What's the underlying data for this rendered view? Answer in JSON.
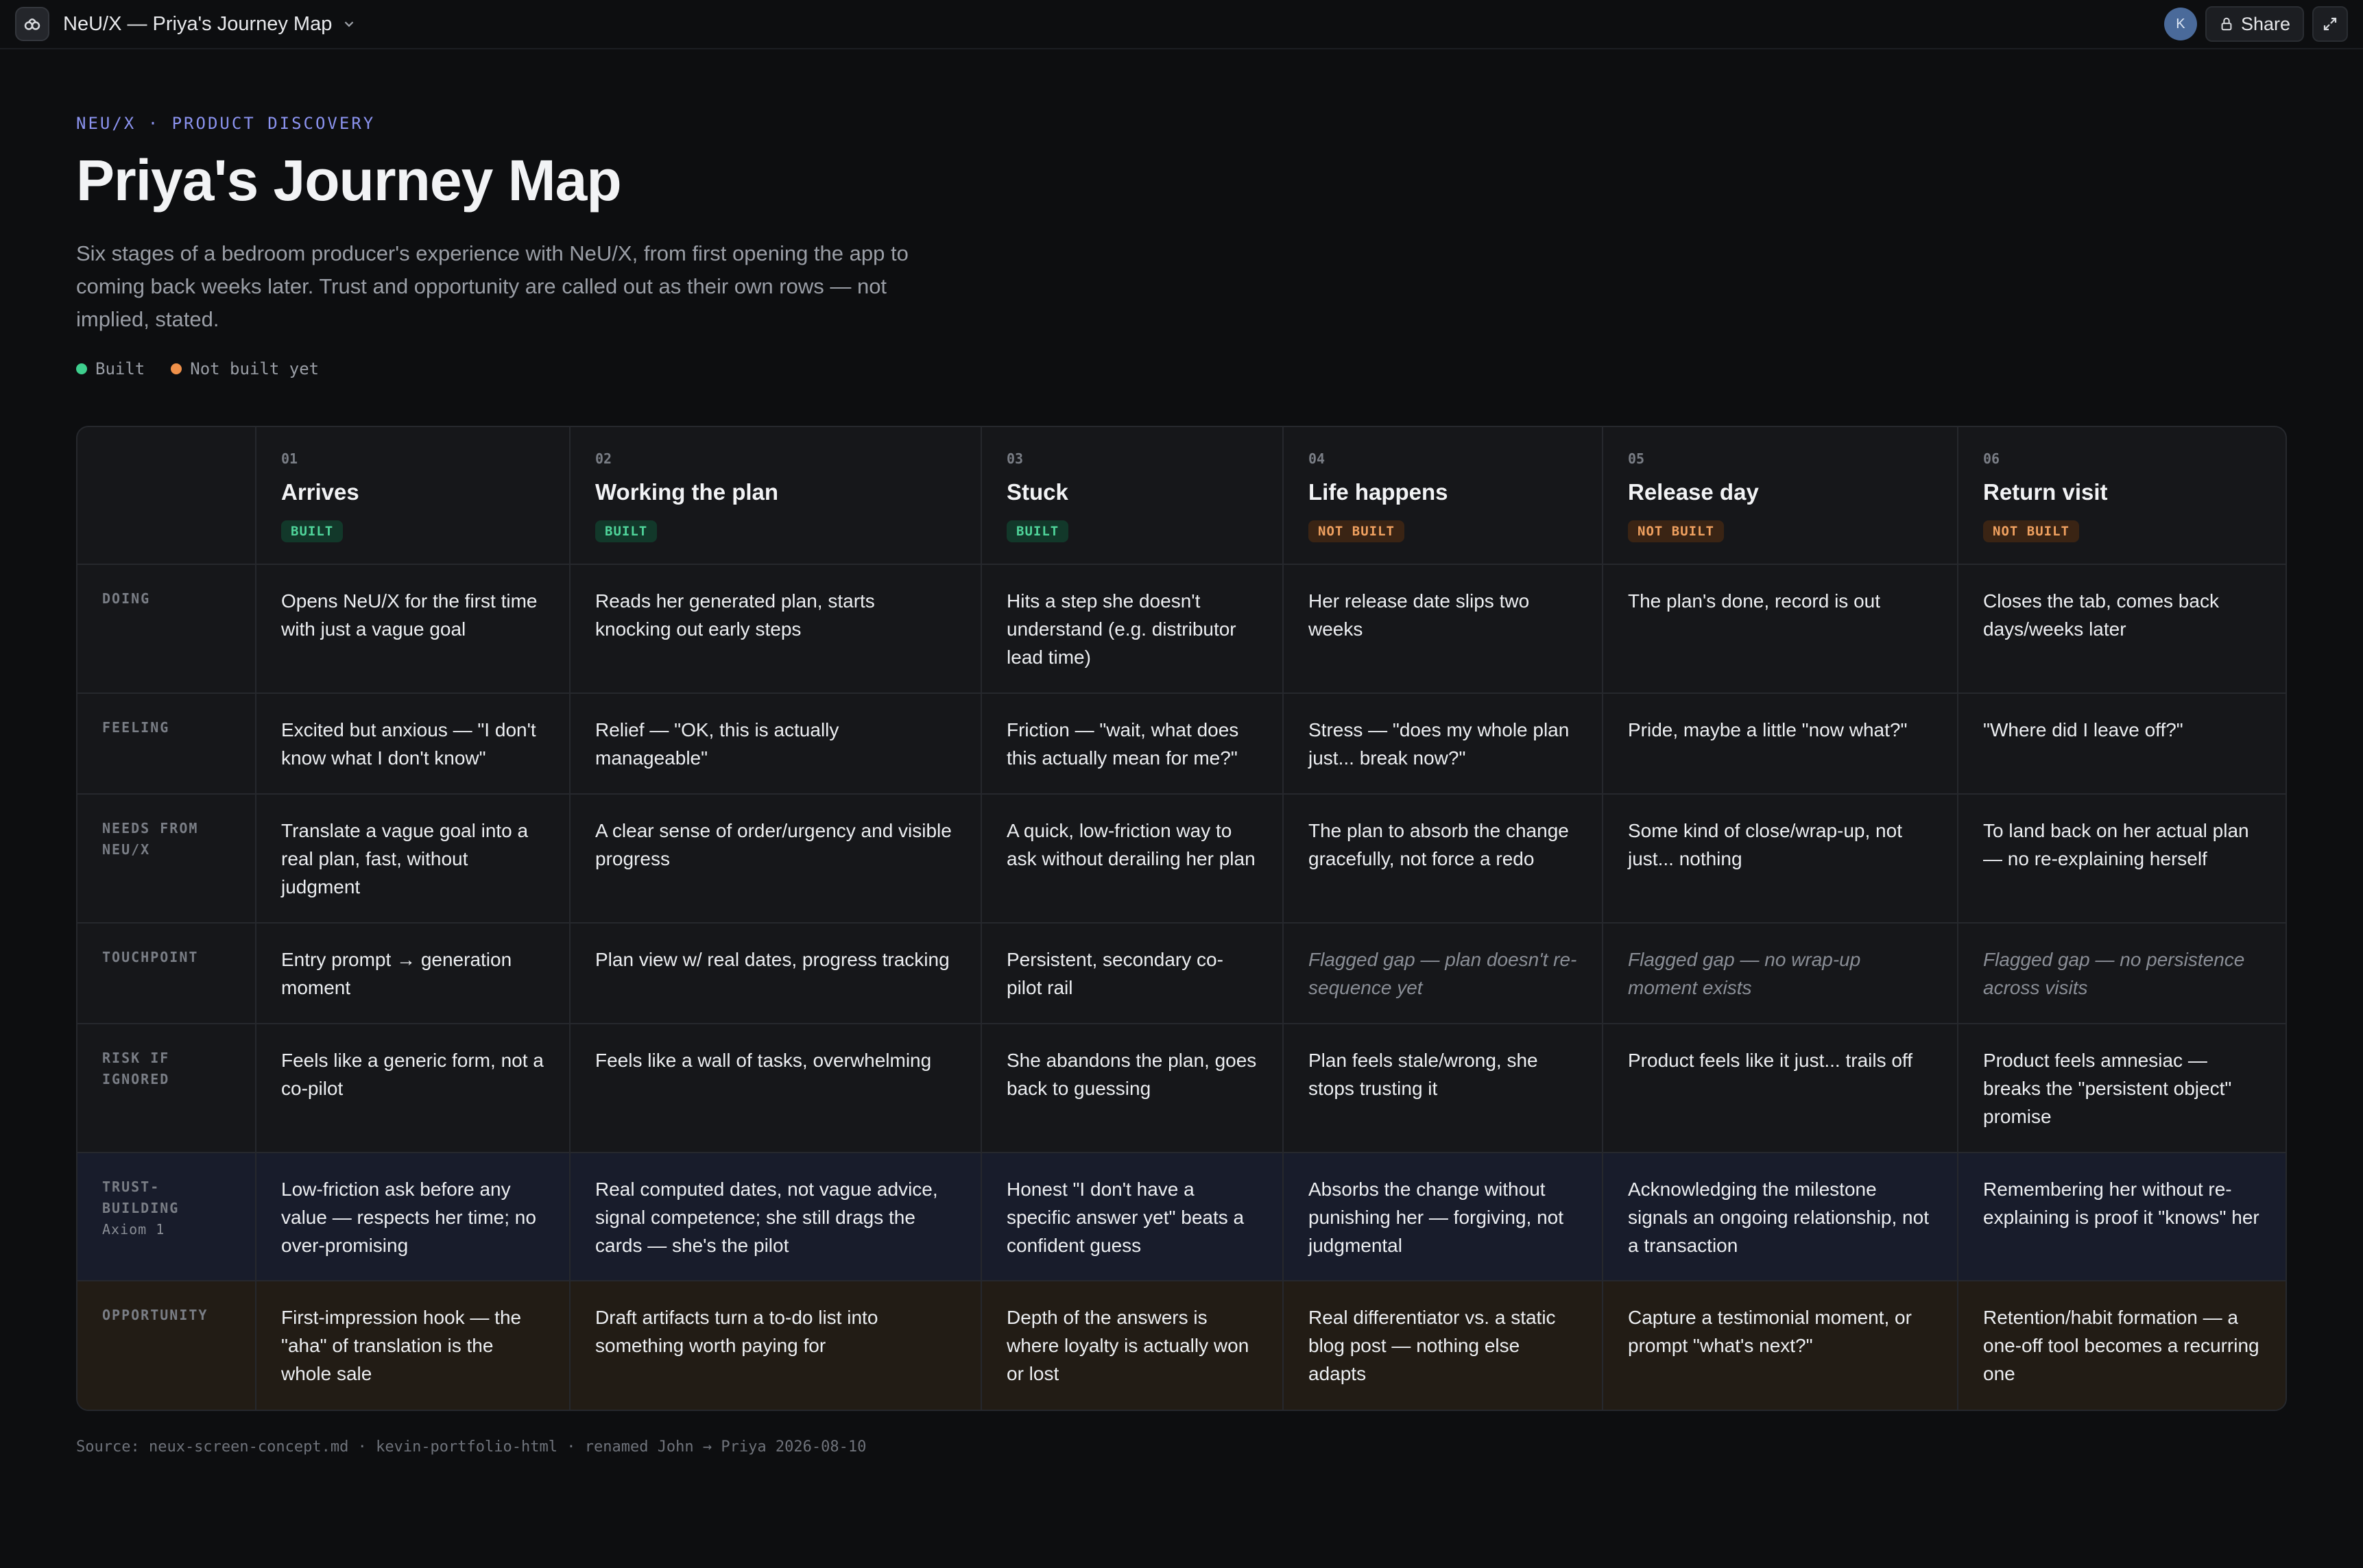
{
  "topbar": {
    "doc_title": "NeU/X — Priya's Journey Map",
    "avatar_initial": "K",
    "share_label": "Share"
  },
  "header": {
    "eyebrow": "NEU/X · PRODUCT DISCOVERY",
    "title": "Priya's Journey Map",
    "subtitle": "Six stages of a bedroom producer's experience with NeU/X, from first opening the app to coming back weeks later. Trust and opportunity are called out as their own rows — not implied, stated."
  },
  "legend": {
    "built": "Built",
    "not_built": "Not built yet",
    "built_color": "#3ecf8e",
    "not_built_color": "#f0914a"
  },
  "stages": [
    {
      "num": "01",
      "name": "Arrives",
      "status": "BUILT"
    },
    {
      "num": "02",
      "name": "Working the plan",
      "status": "BUILT"
    },
    {
      "num": "03",
      "name": "Stuck",
      "status": "BUILT"
    },
    {
      "num": "04",
      "name": "Life happens",
      "status": "NOT BUILT"
    },
    {
      "num": "05",
      "name": "Release day",
      "status": "NOT BUILT"
    },
    {
      "num": "06",
      "name": "Return visit",
      "status": "NOT BUILT"
    }
  ],
  "rows": [
    {
      "label": "DOING",
      "cells": [
        "Opens NeU/X for the first time with just a vague goal",
        "Reads her generated plan, starts knocking out early steps",
        "Hits a step she doesn't understand (e.g. distributor lead time)",
        "Her release date slips two weeks",
        "The plan's done, record is out",
        "Closes the tab, comes back days/weeks later"
      ]
    },
    {
      "label": "FEELING",
      "cells": [
        "Excited but anxious — \"I don't know what I don't know\"",
        "Relief — \"OK, this is actually manageable\"",
        "Friction — \"wait, what does this actually mean for me?\"",
        "Stress — \"does my whole plan just... break now?\"",
        "Pride, maybe a little \"now what?\"",
        "\"Where did I leave off?\""
      ]
    },
    {
      "label": "NEEDS FROM NEU/X",
      "cells": [
        "Translate a vague goal into a real plan, fast, without judgment",
        "A clear sense of order/urgency and visible progress",
        "A quick, low-friction way to ask without derailing her plan",
        "The plan to absorb the change gracefully, not force a redo",
        "Some kind of close/wrap-up, not just... nothing",
        "To land back on her actual plan — no re-explaining herself"
      ]
    },
    {
      "label": "TOUCHPOINT",
      "cells": [
        "Entry prompt → generation moment",
        "Plan view w/ real dates, progress tracking",
        "Persistent, secondary co-pilot rail",
        "Flagged gap — plan doesn't re-sequence yet",
        "Flagged gap — no wrap-up moment exists",
        "Flagged gap — no persistence across visits"
      ]
    },
    {
      "label": "RISK IF IGNORED",
      "cells": [
        "Feels like a generic form, not a co-pilot",
        "Feels like a wall of tasks, overwhelming",
        "She abandons the plan, goes back to guessing",
        "Plan feels stale/wrong, she stops trusting it",
        "Product feels like it just... trails off",
        "Product feels amnesiac — breaks the \"persistent object\" promise"
      ]
    },
    {
      "label": "TRUST-BUILDING",
      "sublabel": "Axiom 1",
      "cells": [
        "Low-friction ask before any value — respects her time; no over-promising",
        "Real computed dates, not vague advice, signal competence; she still drags the cards — she's the pilot",
        "Honest \"I don't have a specific answer yet\" beats a confident guess",
        "Absorbs the change without punishing her — forgiving, not judgmental",
        "Acknowledging the milestone signals an ongoing relationship, not a transaction",
        "Remembering her without re-explaining is proof it \"knows\" her"
      ]
    },
    {
      "label": "OPPORTUNITY",
      "cells": [
        "First-impression hook — the \"aha\" of translation is the whole sale",
        "Draft artifacts turn a to-do list into something worth paying for",
        "Depth of the answers is where loyalty is actually won or lost",
        "Real differentiator vs. a static blog post — nothing else adapts",
        "Capture a testimonial moment, or prompt \"what's next?\"",
        "Retention/habit formation — a one-off tool becomes a recurring one"
      ]
    }
  ],
  "footer": {
    "source": "Source: neux-screen-concept.md · kevin-portfolio-html · renamed John → Priya 2026-08-10"
  }
}
